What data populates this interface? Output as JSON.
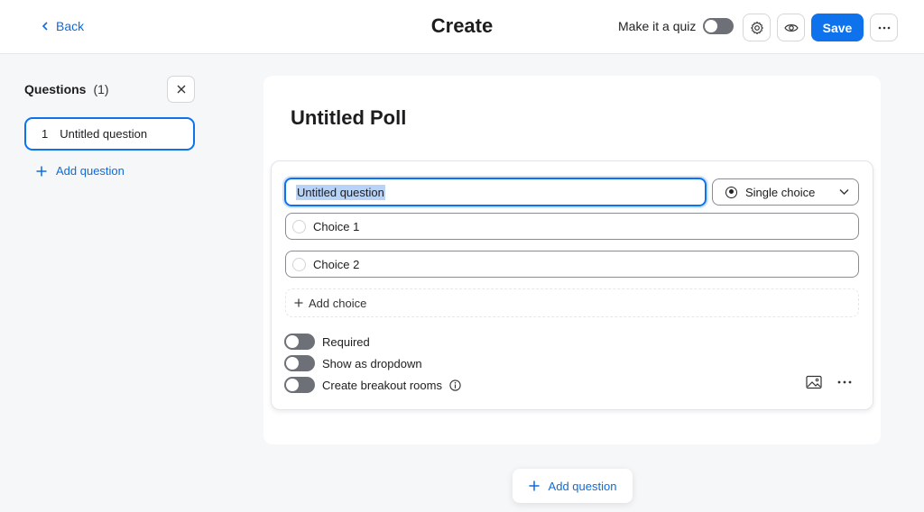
{
  "header": {
    "back_label": "Back",
    "title": "Create",
    "quiz_label": "Make it a quiz",
    "quiz_enabled": false,
    "save_label": "Save"
  },
  "sidebar": {
    "title": "Questions",
    "count": "(1)",
    "items": [
      {
        "number": "1",
        "label": "Untitled question"
      }
    ],
    "add_label": "Add question"
  },
  "poll": {
    "title": "Untitled Poll",
    "question": {
      "value": "Untitled question",
      "type_label": "Single choice",
      "choices": [
        "Choice 1",
        "Choice 2"
      ],
      "add_choice_label": "Add choice",
      "options": [
        {
          "label": "Required",
          "enabled": false
        },
        {
          "label": "Show as dropdown",
          "enabled": false
        },
        {
          "label": "Create breakout rooms",
          "enabled": false
        }
      ]
    },
    "add_question_label": "Add question"
  },
  "colors": {
    "accent": "#0e72ed",
    "link": "#0e6bdc",
    "toggle_off": "#6e7077"
  },
  "icons": [
    "chevron-left-icon",
    "gear-icon",
    "eye-icon",
    "more-horizontal-icon",
    "close-icon",
    "plus-icon",
    "radio-icon",
    "chevron-down-icon",
    "info-icon",
    "image-icon"
  ]
}
